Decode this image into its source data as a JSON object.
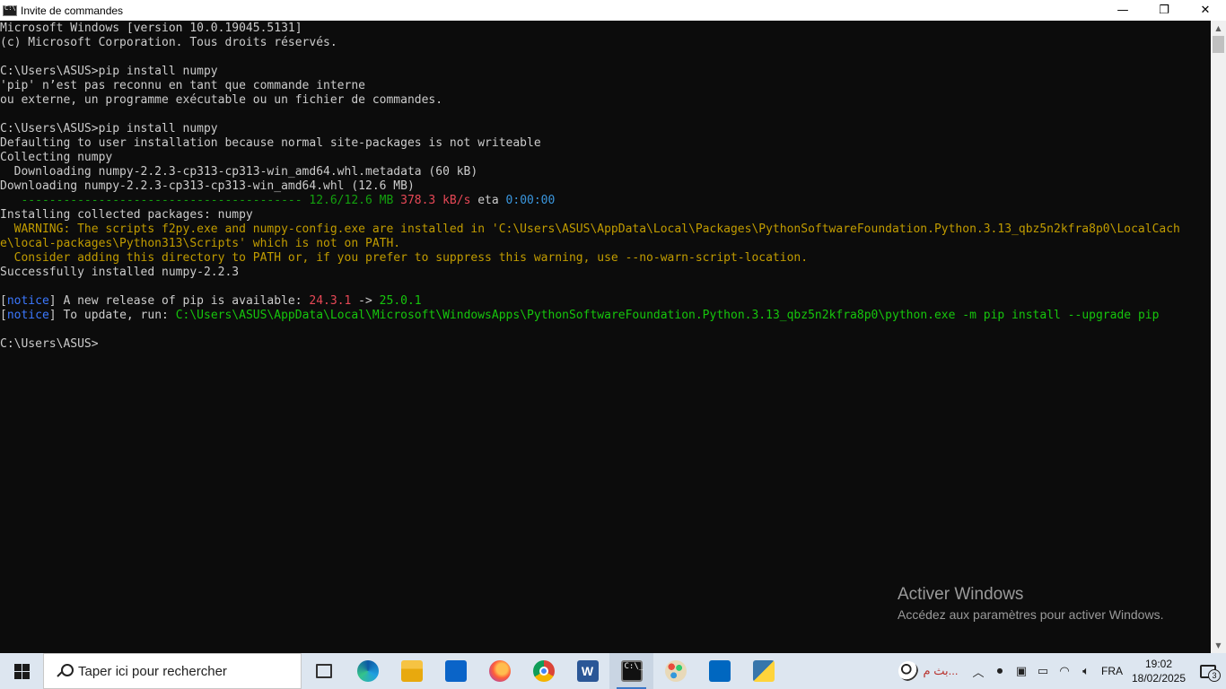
{
  "window": {
    "title": "Invite de commandes",
    "minimize": "—",
    "maximize": "❐",
    "close": "✕"
  },
  "console": {
    "lines": [
      [
        {
          "t": "Microsoft Windows [version 10.0.19045.5131]"
        }
      ],
      [
        {
          "t": "(c) Microsoft Corporation. Tous droits réservés."
        }
      ],
      [
        {
          "t": ""
        }
      ],
      [
        {
          "t": "C:\\Users\\ASUS>pip install numpy"
        }
      ],
      [
        {
          "t": "'pip' n’est pas reconnu en tant que commande interne"
        }
      ],
      [
        {
          "t": "ou externe, un programme exécutable ou un fichier de commandes."
        }
      ],
      [
        {
          "t": ""
        }
      ],
      [
        {
          "t": "C:\\Users\\ASUS>pip install numpy"
        }
      ],
      [
        {
          "t": "Defaulting to user installation because normal site-packages is not writeable"
        }
      ],
      [
        {
          "t": "Collecting numpy"
        }
      ],
      [
        {
          "t": "  Downloading numpy-2.2.3-cp313-cp313-win_amd64.whl.metadata (60 kB)"
        }
      ],
      [
        {
          "t": "Downloading numpy-2.2.3-cp313-cp313-win_amd64.whl (12.6 MB)"
        }
      ],
      [
        {
          "t": "   ---------------------------------------- ",
          "c": "c-green"
        },
        {
          "t": "12.6/12.6 MB",
          "c": "c-green"
        },
        {
          "t": " "
        },
        {
          "t": "378.3 kB/s",
          "c": "c-red"
        },
        {
          "t": " eta "
        },
        {
          "t": "0:00:00",
          "c": "c-cyan"
        }
      ],
      [
        {
          "t": "Installing collected packages: numpy"
        }
      ],
      [
        {
          "t": "  WARNING: The scripts f2py.exe and numpy-config.exe are installed in 'C:\\Users\\ASUS\\AppData\\Local\\Packages\\PythonSoftwareFoundation.Python.3.13_qbz5n2kfra8p0\\LocalCach",
          "c": "c-yellow"
        }
      ],
      [
        {
          "t": "e\\local-packages\\Python313\\Scripts' which is not on PATH.",
          "c": "c-yellow"
        }
      ],
      [
        {
          "t": "  Consider adding this directory to PATH or, if you prefer to suppress this warning, use --no-warn-script-location.",
          "c": "c-yellow"
        }
      ],
      [
        {
          "t": "Successfully installed numpy-2.2.3"
        }
      ],
      [
        {
          "t": ""
        }
      ],
      [
        {
          "t": "["
        },
        {
          "t": "notice",
          "c": "c-blue"
        },
        {
          "t": "] A new release of pip is available: "
        },
        {
          "t": "24.3.1",
          "c": "c-red"
        },
        {
          "t": " -> "
        },
        {
          "t": "25.0.1",
          "c": "c-bgreen"
        }
      ],
      [
        {
          "t": "["
        },
        {
          "t": "notice",
          "c": "c-blue"
        },
        {
          "t": "] To update, run: "
        },
        {
          "t": "C:\\Users\\ASUS\\AppData\\Local\\Microsoft\\WindowsApps\\PythonSoftwareFoundation.Python.3.13_qbz5n2kfra8p0\\python.exe -m pip install --upgrade pip",
          "c": "c-bgreen"
        }
      ],
      [
        {
          "t": ""
        }
      ],
      [
        {
          "t": "C:\\Users\\ASUS>"
        }
      ]
    ]
  },
  "scrollbar": {
    "up": "▲",
    "down": "▼"
  },
  "watermark": {
    "title": "Activer Windows",
    "subtitle": "Accédez aux paramètres pour activer Windows."
  },
  "taskbar": {
    "search_placeholder": "Taper ici pour rechercher",
    "word_letter": "W",
    "cmd_glyph": "C:\\_",
    "tray_news": "بث م...",
    "tray_chevron": "︿",
    "language": "FRA",
    "time": "19:02",
    "date": "18/02/2025",
    "notification_count": "3"
  }
}
